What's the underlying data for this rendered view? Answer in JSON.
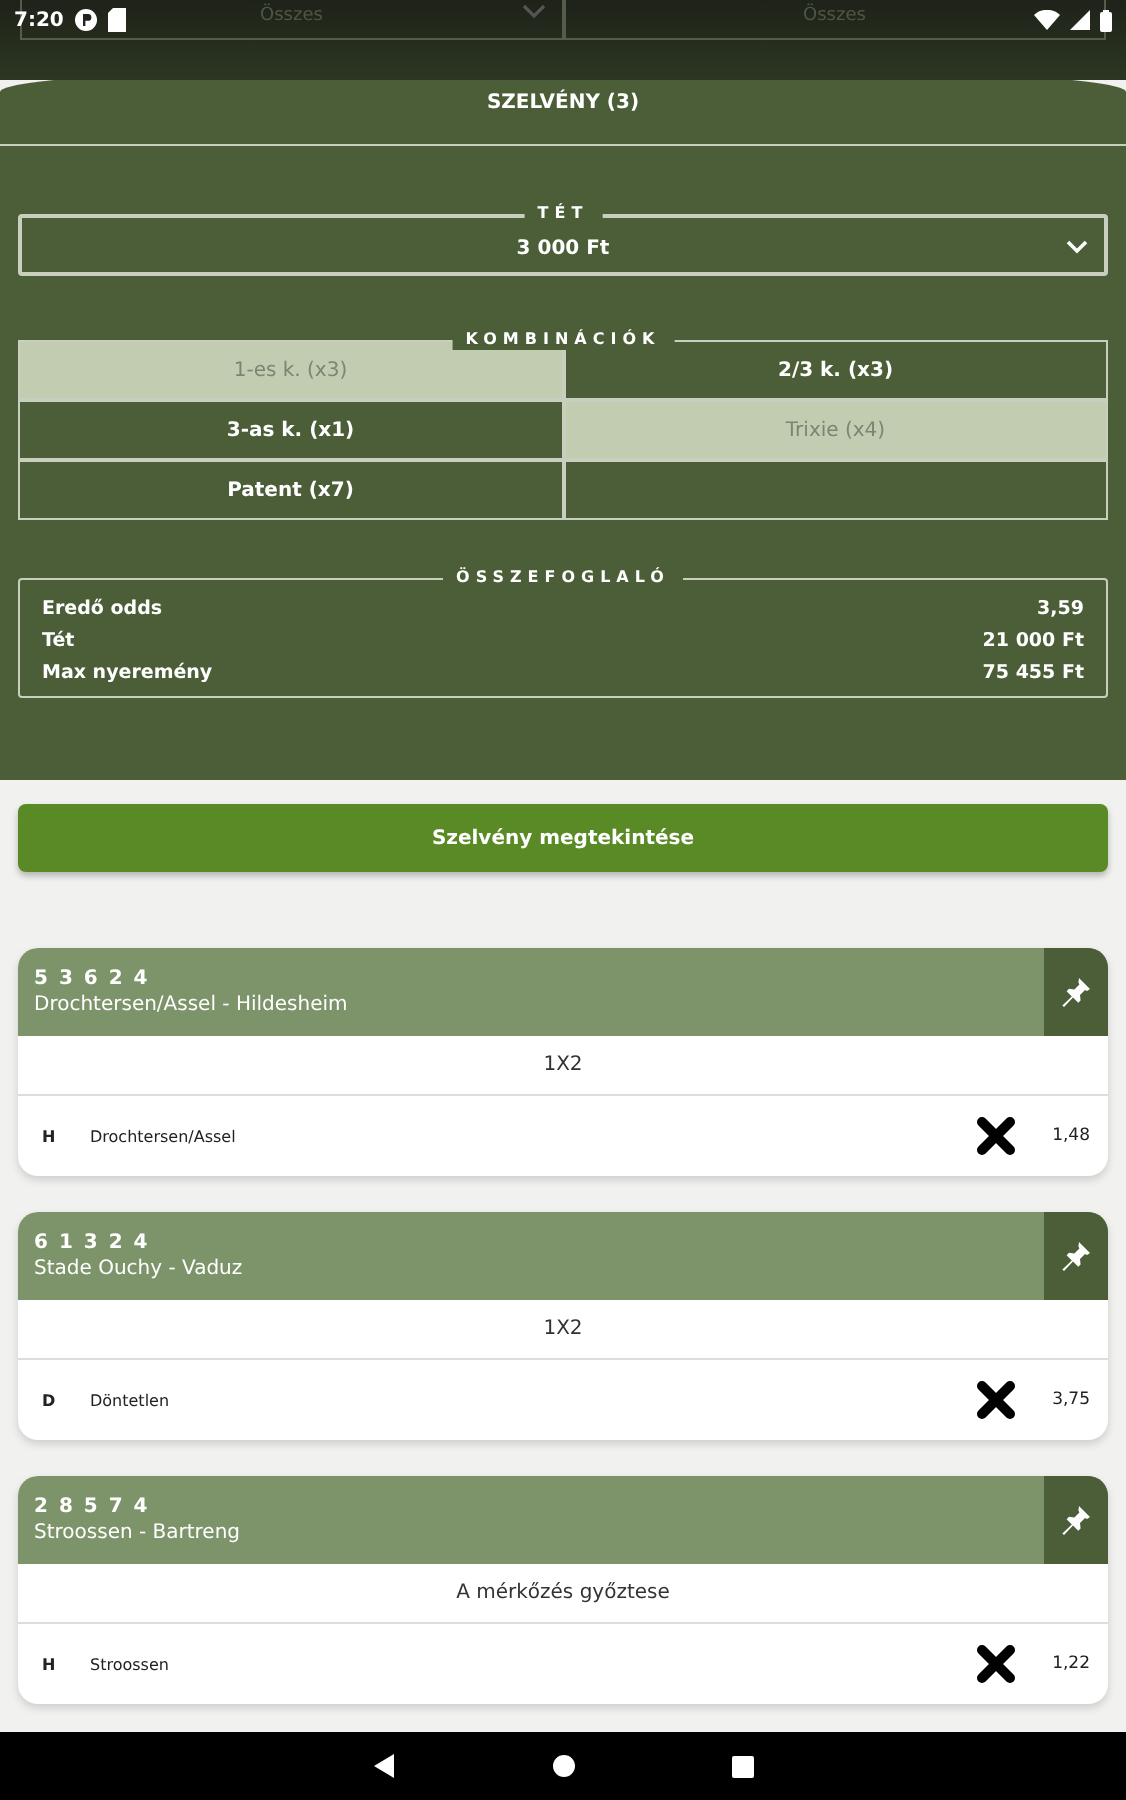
{
  "status_bar": {
    "time": "7:20"
  },
  "filters": [
    {
      "value": "Összes",
      "dropdown": true
    },
    {
      "value": "Összes",
      "dropdown": false
    }
  ],
  "title": "SZELVÉNY (3)",
  "stake": {
    "label": "TÉT",
    "value": "3 000 Ft"
  },
  "combinations": {
    "label": "KOMBINÁCIÓK",
    "items": [
      {
        "label": "1-es k. (x3)",
        "selected": true
      },
      {
        "label": "2/3 k. (x3)",
        "selected": false
      },
      {
        "label": "3-as k. (x1)",
        "selected": false
      },
      {
        "label": "Trixie (x4)",
        "selected": true
      },
      {
        "label": "Patent (x7)",
        "selected": false
      }
    ]
  },
  "summary": {
    "label": "ÖSSZEFOGLALÓ",
    "rows": [
      {
        "label": "Eredő odds",
        "value": "3,59"
      },
      {
        "label": "Tét",
        "value": "21 000 Ft"
      },
      {
        "label": "Max nyeremény",
        "value": "75 455 Ft"
      }
    ]
  },
  "view_button": "Szelvény megtekintése",
  "bets": [
    {
      "code": "5 3 6 2 4",
      "match": "Drochtersen/Assel - Hildesheim",
      "market": "1X2",
      "outcome": "H",
      "selection": "Drochtersen/Assel",
      "odds": "1,48"
    },
    {
      "code": "6 1 3 2 4",
      "match": "Stade Ouchy - Vaduz",
      "market": "1X2",
      "outcome": "D",
      "selection": "Döntetlen",
      "odds": "3,75"
    },
    {
      "code": "2 8 5 7 4",
      "match": "Stroossen - Bartreng",
      "market": "A mérkőzés győztese",
      "outcome": "H",
      "selection": "Stroossen",
      "odds": "1,22"
    }
  ]
}
